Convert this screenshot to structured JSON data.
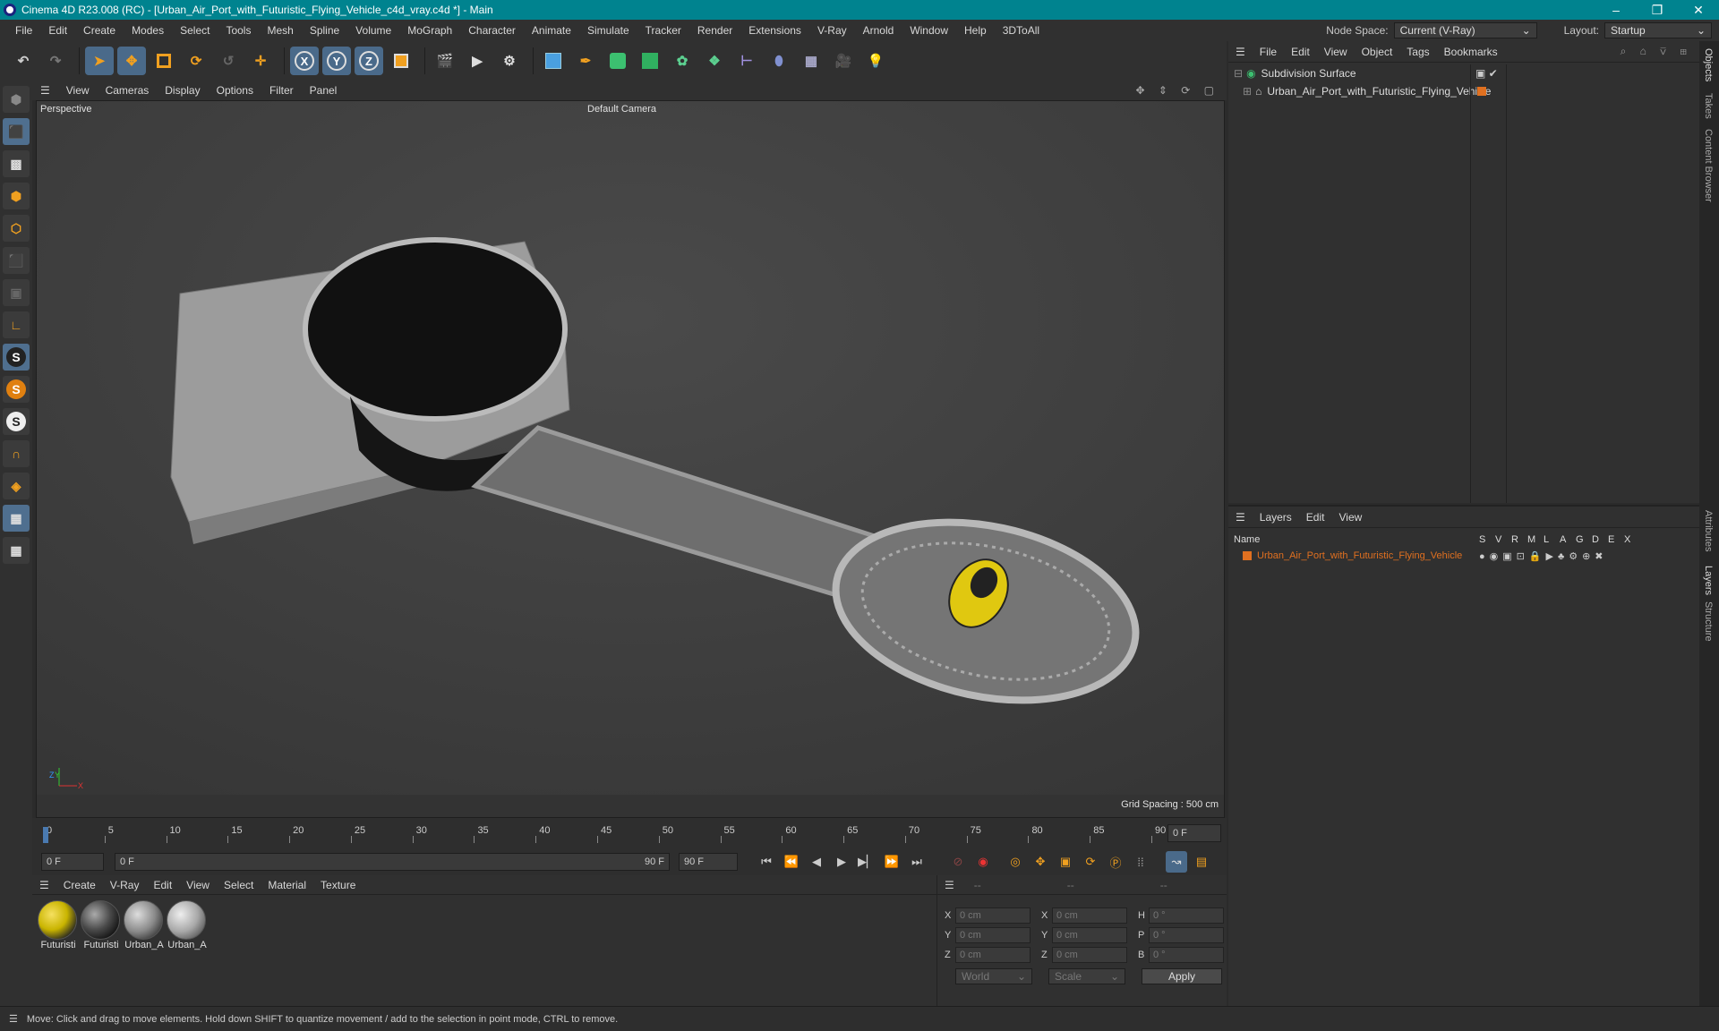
{
  "window": {
    "title": "Cinema 4D R23.008 (RC) - [Urban_Air_Port_with_Futuristic_Flying_Vehicle_c4d_vray.c4d *] - Main",
    "controls": [
      "–",
      "❐",
      "✕"
    ]
  },
  "menubar": {
    "items": [
      "File",
      "Edit",
      "Create",
      "Modes",
      "Select",
      "Tools",
      "Mesh",
      "Spline",
      "Volume",
      "MoGraph",
      "Character",
      "Animate",
      "Simulate",
      "Tracker",
      "Render",
      "Extensions",
      "V-Ray",
      "Arnold",
      "Window",
      "Help",
      "3DToAll"
    ],
    "node_space_label": "Node Space:",
    "node_space_value": "Current (V-Ray)",
    "layout_label": "Layout:",
    "layout_value": "Startup"
  },
  "toolbar": {
    "axis_x": "X",
    "axis_y": "Y",
    "axis_z": "Z"
  },
  "viewport_menu": {
    "items": [
      "View",
      "Cameras",
      "Display",
      "Options",
      "Filter",
      "Panel"
    ]
  },
  "viewport": {
    "view_name": "Perspective",
    "camera": "Default Camera",
    "grid_spacing": "Grid Spacing : 500 cm",
    "axis_y": "Y",
    "axis_x": "X",
    "axis_z": "Z"
  },
  "timeline": {
    "ticks": [
      "0",
      "5",
      "10",
      "15",
      "20",
      "25",
      "30",
      "35",
      "40",
      "45",
      "50",
      "55",
      "60",
      "65",
      "70",
      "75",
      "80",
      "85",
      "90"
    ],
    "current_frame_field": "0 F",
    "playhead_fraction": 0.0
  },
  "playback": {
    "start_field": "0 F",
    "range_start": "0 F",
    "range_end": "90 F",
    "end_field": "90 F"
  },
  "material_manager": {
    "menu": [
      "Create",
      "V-Ray",
      "Edit",
      "View",
      "Select",
      "Material",
      "Texture"
    ],
    "materials": [
      {
        "name": "Futuristi",
        "color": "#c9b400"
      },
      {
        "name": "Futuristi",
        "color": "#4a4a4a"
      },
      {
        "name": "Urban_A",
        "color": "#8a8a8a"
      },
      {
        "name": "Urban_A",
        "color": "#a8a8a8"
      }
    ]
  },
  "coordinates": {
    "headers": [
      "--",
      "--",
      "--"
    ],
    "rows": [
      {
        "a": "X",
        "av": "0 cm",
        "b": "X",
        "bv": "0 cm",
        "c": "H",
        "cv": "0 °"
      },
      {
        "a": "Y",
        "av": "0 cm",
        "b": "Y",
        "bv": "0 cm",
        "c": "P",
        "cv": "0 °"
      },
      {
        "a": "Z",
        "av": "0 cm",
        "b": "Z",
        "bv": "0 cm",
        "c": "B",
        "cv": "0 °"
      }
    ],
    "space": "World",
    "mode": "Scale",
    "apply": "Apply"
  },
  "object_manager": {
    "menu": [
      "File",
      "Edit",
      "View",
      "Object",
      "Tags",
      "Bookmarks"
    ],
    "objects": [
      {
        "name": "Subdivision Surface"
      },
      {
        "name": "Urban_Air_Port_with_Futuristic_Flying_Vehicle"
      }
    ]
  },
  "layer_manager": {
    "menu": [
      "Layers",
      "Edit",
      "View"
    ],
    "columns": [
      "Name",
      "S",
      "V",
      "R",
      "M",
      "L",
      "A",
      "G",
      "D",
      "E",
      "X"
    ],
    "layers": [
      {
        "name": "Urban_Air_Port_with_Futuristic_Flying_Vehicle",
        "color": "#e07020"
      }
    ]
  },
  "right_tabs": [
    "Objects",
    "Takes",
    "Content Browser",
    "Attributes",
    "Layers",
    "Structure"
  ],
  "status": {
    "text": "Move: Click and drag to move elements. Hold down SHIFT to quantize movement / add to the selection in point mode, CTRL to remove."
  },
  "colors": {
    "accent": "#00838f",
    "selection": "#4a6a8a",
    "layer_orange": "#e07020"
  }
}
